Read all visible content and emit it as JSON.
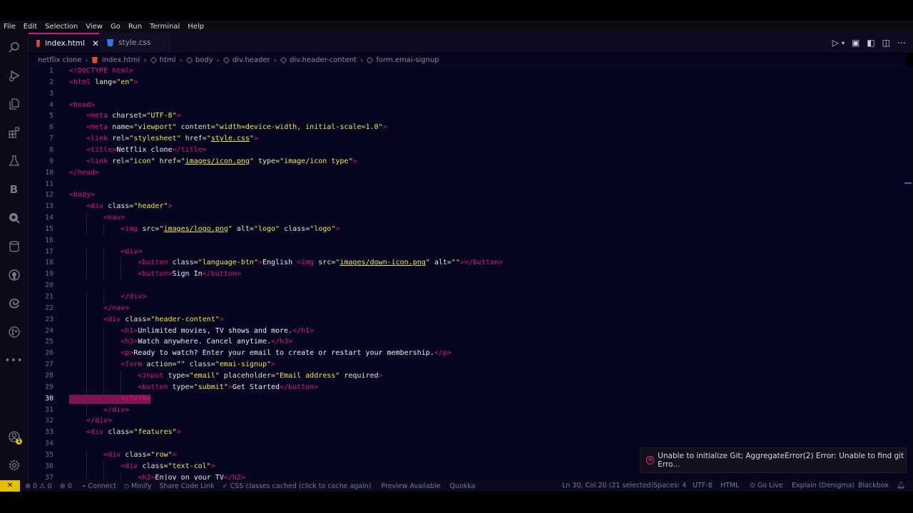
{
  "menu": [
    "File",
    "Edit",
    "Selection",
    "View",
    "Go",
    "Run",
    "Terminal",
    "Help"
  ],
  "activity_bar": {
    "items": [
      "search-icon",
      "run-debug-icon",
      "explorer-icon",
      "extensions-icon",
      "testing-icon",
      "blackbox-icon",
      "quokka-icon",
      "database-icon",
      "github-icon",
      "edge-devtools-icon",
      "git-graph-icon",
      "more-icon"
    ],
    "bottom": [
      "accounts-icon",
      "settings-icon"
    ],
    "badge": "1"
  },
  "tabs": [
    {
      "label": "index.html",
      "active": true
    },
    {
      "label": "style.css",
      "active": false
    }
  ],
  "breadcrumb": [
    "netflix clone",
    "index.html",
    "html",
    "body",
    "div.header",
    "div.header-content",
    "form.emai-signup"
  ],
  "editor": {
    "current_line": 30,
    "lines": [
      [
        [
          "t",
          "<!DOCTYPE html>"
        ]
      ],
      [
        [
          "t",
          "<html "
        ],
        [
          "a",
          "lang="
        ],
        [
          "s",
          "\"en\""
        ],
        [
          "t",
          ">"
        ]
      ],
      [],
      [
        [
          "t",
          "<head>"
        ]
      ],
      [
        [
          "x",
          "    "
        ],
        [
          "t",
          "<meta "
        ],
        [
          "a",
          "charset="
        ],
        [
          "s",
          "\"UTF-8\""
        ],
        [
          "t",
          ">"
        ]
      ],
      [
        [
          "x",
          "    "
        ],
        [
          "t",
          "<meta "
        ],
        [
          "a",
          "name="
        ],
        [
          "s",
          "\"viewport\" "
        ],
        [
          "a",
          "content="
        ],
        [
          "s",
          "\"width=device-width, initial-scale=1.0\""
        ],
        [
          "t",
          ">"
        ]
      ],
      [
        [
          "x",
          "    "
        ],
        [
          "t",
          "<link "
        ],
        [
          "a",
          "rel="
        ],
        [
          "s",
          "\"stylesheet\" "
        ],
        [
          "a",
          "href="
        ],
        [
          "s",
          "\""
        ],
        [
          "u",
          "style.css"
        ],
        [
          "s",
          "\""
        ],
        [
          "t",
          ">"
        ]
      ],
      [
        [
          "x",
          "    "
        ],
        [
          "t",
          "<title>"
        ],
        [
          "p",
          "Netflix clone"
        ],
        [
          "t",
          "</title>"
        ]
      ],
      [
        [
          "x",
          "    "
        ],
        [
          "t",
          "<link "
        ],
        [
          "a",
          "rel="
        ],
        [
          "s",
          "\"icon\" "
        ],
        [
          "a",
          "href="
        ],
        [
          "s",
          "\""
        ],
        [
          "u",
          "images/icon.png"
        ],
        [
          "s",
          "\" "
        ],
        [
          "a",
          "type="
        ],
        [
          "s",
          "\"image/icon type\""
        ],
        [
          "t",
          ">"
        ]
      ],
      [
        [
          "t",
          "</head>"
        ]
      ],
      [],
      [
        [
          "t",
          "<body>"
        ]
      ],
      [
        [
          "x",
          "    "
        ],
        [
          "t",
          "<div "
        ],
        [
          "a",
          "class="
        ],
        [
          "s",
          "\"header\""
        ],
        [
          "t",
          ">"
        ]
      ],
      [
        [
          "x",
          "        "
        ],
        [
          "t",
          "<nav>"
        ]
      ],
      [
        [
          "x",
          "            "
        ],
        [
          "t",
          "<img "
        ],
        [
          "a",
          "src="
        ],
        [
          "s",
          "\""
        ],
        [
          "u",
          "images/logo.png"
        ],
        [
          "s",
          "\" "
        ],
        [
          "a",
          "alt="
        ],
        [
          "s",
          "\"logo\" "
        ],
        [
          "a",
          "class="
        ],
        [
          "s",
          "\"logo\""
        ],
        [
          "t",
          ">"
        ]
      ],
      [],
      [
        [
          "x",
          "            "
        ],
        [
          "t",
          "<div>"
        ]
      ],
      [
        [
          "x",
          "                "
        ],
        [
          "t",
          "<button "
        ],
        [
          "a",
          "class="
        ],
        [
          "s",
          "\"language-btn\""
        ],
        [
          "t",
          ">"
        ],
        [
          "p",
          "English "
        ],
        [
          "t",
          "<img "
        ],
        [
          "a",
          "src="
        ],
        [
          "s",
          "\""
        ],
        [
          "u",
          "images/down-icon.png"
        ],
        [
          "s",
          "\" "
        ],
        [
          "a",
          "alt="
        ],
        [
          "s",
          "\"\""
        ],
        [
          "t",
          "></button>"
        ]
      ],
      [
        [
          "x",
          "                "
        ],
        [
          "t",
          "<button>"
        ],
        [
          "p",
          "Sign In"
        ],
        [
          "t",
          "</button>"
        ]
      ],
      [],
      [
        [
          "x",
          "            "
        ],
        [
          "t",
          "</div>"
        ]
      ],
      [
        [
          "x",
          "        "
        ],
        [
          "t",
          "</nav>"
        ]
      ],
      [
        [
          "x",
          "        "
        ],
        [
          "t",
          "<div "
        ],
        [
          "a",
          "class="
        ],
        [
          "s",
          "\"header-content\""
        ],
        [
          "t",
          ">"
        ]
      ],
      [
        [
          "x",
          "            "
        ],
        [
          "t",
          "<h1>"
        ],
        [
          "p",
          "Unlimited movies, TV shows and more."
        ],
        [
          "t",
          "</h1>"
        ]
      ],
      [
        [
          "x",
          "            "
        ],
        [
          "t",
          "<h3>"
        ],
        [
          "p",
          "Watch anywhere. Cancel anytime."
        ],
        [
          "t",
          "</h3>"
        ]
      ],
      [
        [
          "x",
          "            "
        ],
        [
          "t",
          "<p>"
        ],
        [
          "p",
          "Ready to watch? Enter your email to create or restart your membership."
        ],
        [
          "t",
          "</p>"
        ]
      ],
      [
        [
          "x",
          "            "
        ],
        [
          "t",
          "<form "
        ],
        [
          "a",
          "action="
        ],
        [
          "s",
          "\"\" "
        ],
        [
          "a",
          "class="
        ],
        [
          "s",
          "\"emai-signup\""
        ],
        [
          "t",
          ">"
        ]
      ],
      [
        [
          "x",
          "                "
        ],
        [
          "t",
          "<input "
        ],
        [
          "a",
          "type="
        ],
        [
          "s",
          "\"email\" "
        ],
        [
          "a",
          "placeholder="
        ],
        [
          "s",
          "\"Email address\" "
        ],
        [
          "a",
          "required"
        ],
        [
          "t",
          ">"
        ]
      ],
      [
        [
          "x",
          "                "
        ],
        [
          "t",
          "<button "
        ],
        [
          "a",
          "type="
        ],
        [
          "s",
          "\"submit\""
        ],
        [
          "t",
          ">"
        ],
        [
          "p",
          "Get Started"
        ],
        [
          "t",
          "</button>"
        ]
      ],
      [
        [
          "x",
          "            "
        ],
        [
          "t",
          "</form>"
        ]
      ],
      [
        [
          "x",
          "        "
        ],
        [
          "t",
          "</div>"
        ]
      ],
      [
        [
          "x",
          "    "
        ],
        [
          "t",
          "</div>"
        ]
      ],
      [
        [
          "x",
          "    "
        ],
        [
          "t",
          "<div "
        ],
        [
          "a",
          "class="
        ],
        [
          "s",
          "\"features\""
        ],
        [
          "t",
          ">"
        ]
      ],
      [],
      [
        [
          "x",
          "        "
        ],
        [
          "t",
          "<div "
        ],
        [
          "a",
          "class="
        ],
        [
          "s",
          "\"row\""
        ],
        [
          "t",
          ">"
        ]
      ],
      [
        [
          "x",
          "            "
        ],
        [
          "t",
          "<div "
        ],
        [
          "a",
          "class="
        ],
        [
          "s",
          "\"text-col\""
        ],
        [
          "t",
          ">"
        ]
      ],
      [
        [
          "x",
          "                "
        ],
        [
          "t",
          "<h2>"
        ],
        [
          "p",
          "Enjoy on your TV"
        ],
        [
          "t",
          "</h2>"
        ]
      ]
    ]
  },
  "notification": {
    "message": "Unable to initialize Git; AggregateError(2) Error: Unable to find git Erro..."
  },
  "status_bar": {
    "remote": "✕",
    "problems": "⊗ 0 ⚠ 0",
    "ports": "0",
    "left_items": [
      "Connect",
      "Minify",
      "Share Code Link",
      "CSS classes cached (click to cache again)",
      "Preview Available",
      "Quokka"
    ],
    "cursor": "Ln 30, Col 20 (21 selected)",
    "spaces": "Spaces: 4",
    "encoding": "UTF-8",
    "language": "HTML",
    "golive": "Go Live",
    "explain": "Explain (Denigma)",
    "blackbox": "Blackbox"
  }
}
